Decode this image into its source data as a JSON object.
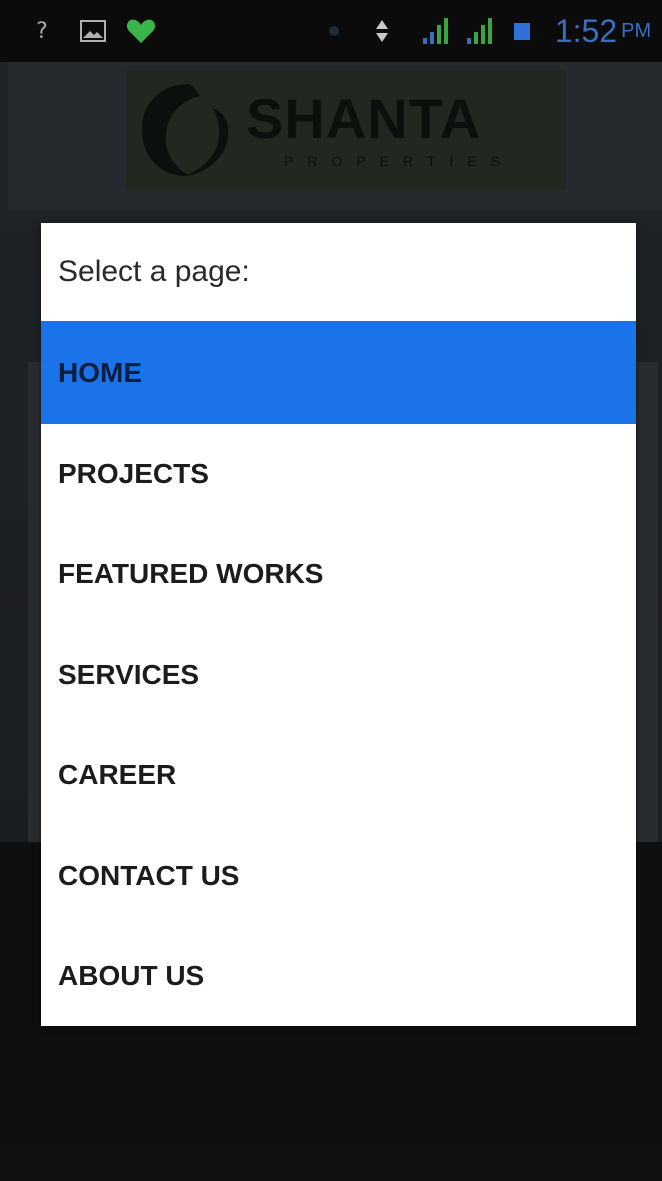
{
  "status_bar": {
    "help_glyph": "?",
    "time": "1:52",
    "ampm": "PM",
    "time_color": "#3a6fbf",
    "heart_color": "#3ab54a",
    "signal_color": "#3aa541",
    "battery_color": "#2e6fd8",
    "icons": [
      "help-icon",
      "image-icon",
      "heart-icon",
      "sync-dot-icon",
      "data-arrows-icon",
      "signal-icon",
      "signal-icon",
      "battery-icon"
    ]
  },
  "app": {
    "logo": {
      "name": "SHANTA",
      "tagline": "PROPERTIES"
    }
  },
  "dialog": {
    "title": "Select a page:",
    "accent_color": "#1a73e8",
    "items": [
      {
        "label": "HOME",
        "selected": true
      },
      {
        "label": "PROJECTS",
        "selected": false
      },
      {
        "label": "FEATURED WORKS",
        "selected": false
      },
      {
        "label": "SERVICES",
        "selected": false
      },
      {
        "label": "CAREER",
        "selected": false
      },
      {
        "label": "CONTACT US",
        "selected": false
      },
      {
        "label": "ABOUT US",
        "selected": false
      }
    ]
  }
}
